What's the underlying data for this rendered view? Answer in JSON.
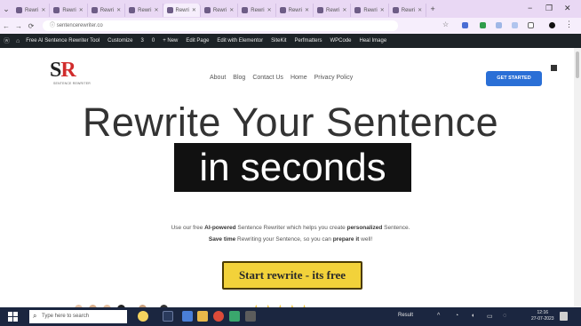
{
  "browser": {
    "tabs": [
      {
        "label": "Rewri"
      },
      {
        "label": "Rewri"
      },
      {
        "label": "Rewri"
      },
      {
        "label": "Rewri"
      },
      {
        "label": "Rewri",
        "active": true
      },
      {
        "label": "Rewri"
      },
      {
        "label": "Rewri"
      },
      {
        "label": "Rewri"
      },
      {
        "label": "Rewri"
      },
      {
        "label": "Rewri"
      },
      {
        "label": "Rewri"
      }
    ],
    "new_tab": "+",
    "menu_caret": "⌄",
    "window_controls": {
      "minimize": "−",
      "maximize": "❐",
      "close": "✕"
    },
    "nav": {
      "back": "←",
      "forward": "→",
      "reload": "⟳",
      "site_info": "ⓘ"
    },
    "url": "sentencerewriter.co",
    "bookmark": "☆",
    "menu": "⋮"
  },
  "wpbar": {
    "items": [
      "Free AI Sentence Rewriter Tool",
      "Customize",
      "3",
      "0",
      "+ New",
      "Edit Page",
      "Edit with Elementor",
      "SiteKit",
      "Perfmatters",
      "WPCode",
      "Heal Image"
    ]
  },
  "site": {
    "logo_mark": "SR",
    "logo_sub": "SENTENCE REWRITER",
    "nav": [
      "About",
      "Blog",
      "Contact Us",
      "Home",
      "Privacy Policy"
    ],
    "cta": "GET STARTED"
  },
  "hero": {
    "line1": "Rewrite Your Sentence",
    "line2": "in seconds",
    "desc1_pre": "Use our free ",
    "desc1_bold1": "AI-powered",
    "desc1_mid": " Sentence Rewriter which helps you create ",
    "desc1_bold2": "personalized",
    "desc1_post": " Sentence.",
    "desc2_bold1": "Save time",
    "desc2_mid": " Rewriting your Sentence, so you can ",
    "desc2_bold2": "prepare it",
    "desc2_post": " well!",
    "button": "Start rewrite - its free",
    "stars": "★★★★★"
  },
  "taskbar": {
    "search_placeholder": "Type here to search",
    "weather": "Result",
    "tray_caret": "^",
    "clock_time": "12:16",
    "clock_date": "27-07-2023"
  },
  "colors": {
    "tab_strip": "#e9d8f4",
    "wp_admin_bar": "#1d2327",
    "cta_blue": "#2a6fd6",
    "start_button": "#f2d23a",
    "taskbar": "#1b2640",
    "logo_red": "#d12c2c"
  },
  "icons": [
    "search-icon",
    "windows-icon",
    "chrome-icon",
    "file-explorer-icon",
    "star-icon",
    "wordpress-icon"
  ]
}
